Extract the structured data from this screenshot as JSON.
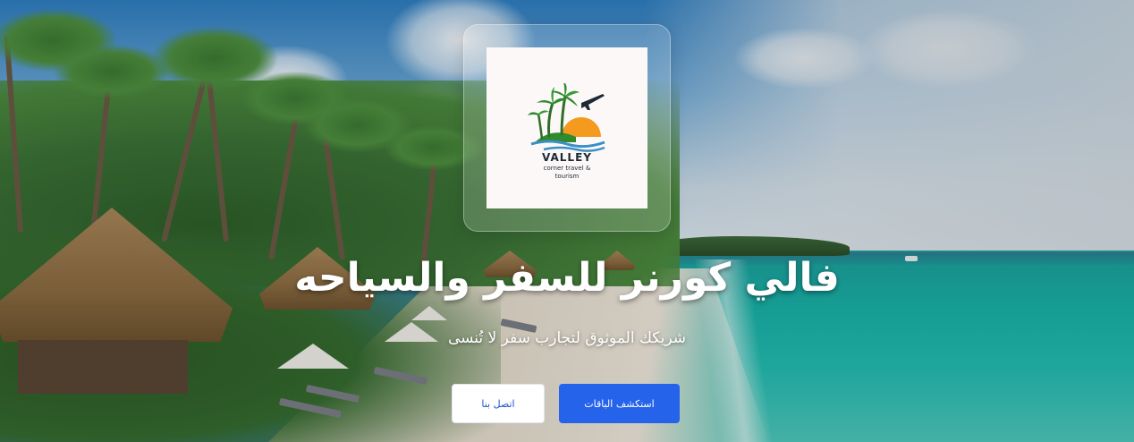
{
  "hero": {
    "logo": {
      "brand_name": "VALLEY",
      "tagline": "corner travel & tourism",
      "icon": "palm-sun-plane-logo"
    },
    "title": "فالي كورنر للسفر والسياحه",
    "subtitle": "شريكك الموثوق لتجارب سفر لا تُنسى",
    "buttons": {
      "contact_label": "اتصل بنا",
      "packages_label": "استكشف الباقات"
    },
    "colors": {
      "primary_button": "#2563eb",
      "secondary_button": "#ffffff",
      "logo_sun": "#f39a1f",
      "logo_palm": "#2e8b2e",
      "logo_water": "#3a8fc7"
    }
  }
}
